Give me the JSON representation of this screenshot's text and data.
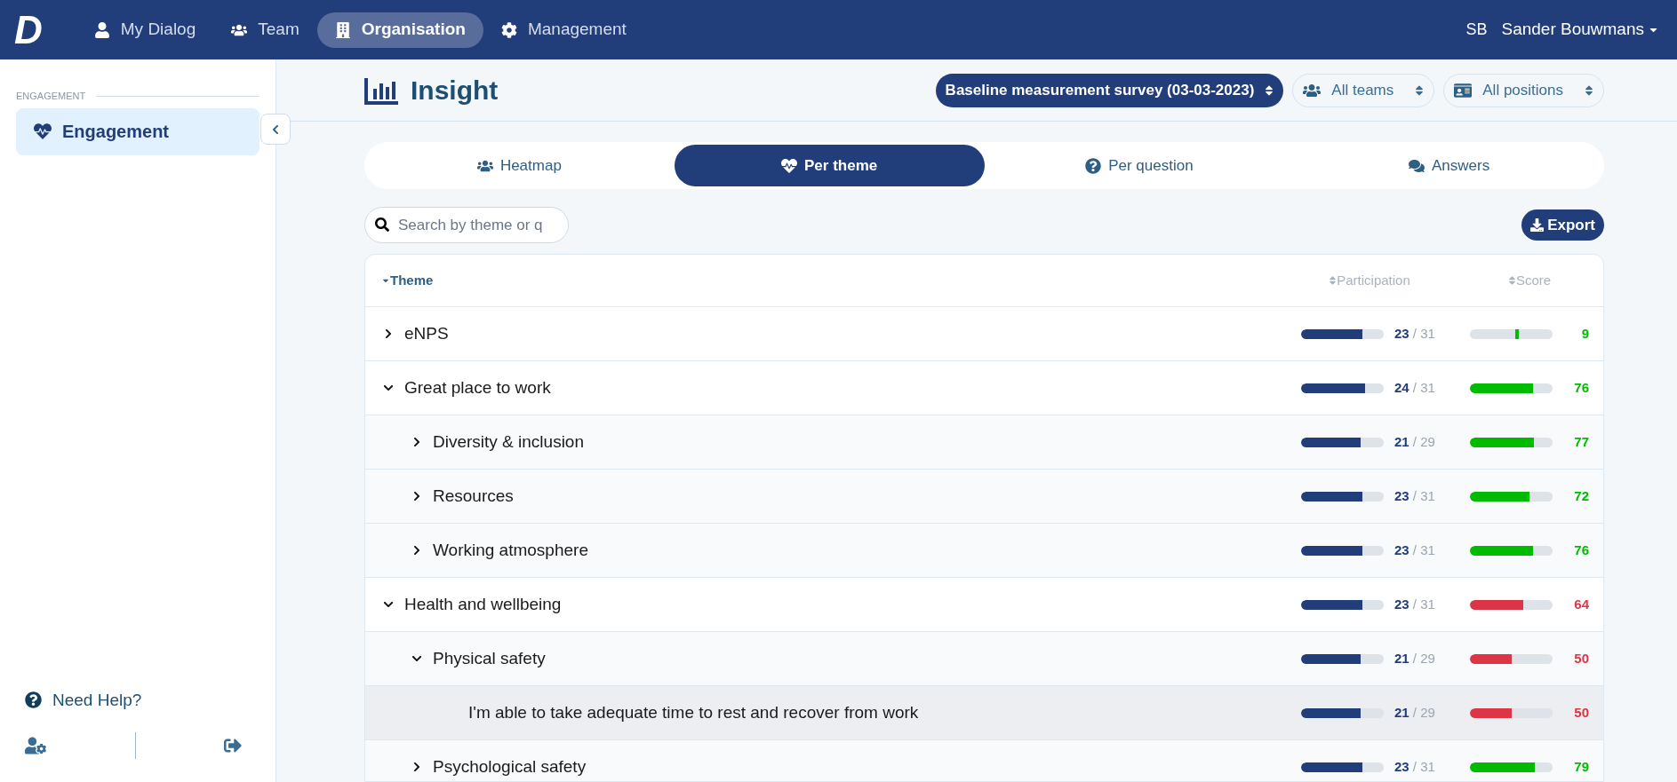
{
  "nav": {
    "logo": "D",
    "items": [
      {
        "label": "My Dialog",
        "selected": false
      },
      {
        "label": "Team",
        "selected": false
      },
      {
        "label": "Organisation",
        "selected": true
      },
      {
        "label": "Management",
        "selected": false
      }
    ],
    "user_initials": "SB",
    "user_name": "Sander Bouwmans"
  },
  "sidebar": {
    "section": "ENGAGEMENT",
    "items": [
      {
        "label": "Engagement",
        "selected": true
      }
    ],
    "help": "Need Help?"
  },
  "header": {
    "title": "Insight",
    "filters": [
      {
        "label": "Baseline measurement survey (03-03-2023)",
        "selected": true
      },
      {
        "label": "All teams",
        "selected": false
      },
      {
        "label": "All positions",
        "selected": false
      }
    ]
  },
  "tabs": [
    {
      "label": "Heatmap",
      "selected": false
    },
    {
      "label": "Per theme",
      "selected": true
    },
    {
      "label": "Per question",
      "selected": false
    },
    {
      "label": "Answers",
      "selected": false
    }
  ],
  "search": {
    "placeholder": "Search by theme or q"
  },
  "export_button": "Export",
  "table": {
    "columns": [
      "Theme",
      "Participation",
      "Score"
    ],
    "rows": [
      {
        "kind": "enps",
        "label": "eNPS",
        "expanded": false,
        "participation": {
          "answered": "23",
          "total": "/ 31",
          "level": 0.74
        },
        "score": {
          "value": "9",
          "level": 0.545,
          "color": "#00bb00"
        }
      },
      {
        "kind": "theme",
        "label": "Great place to work",
        "expanded": true,
        "participation": {
          "answered": "24",
          "total": "/ 31",
          "level": 0.77
        },
        "score": {
          "value": "76",
          "level": 0.76,
          "color": "#00bb00"
        },
        "children": [
          {
            "kind": "theme",
            "label": "Diversity & inclusion",
            "expanded": false,
            "participation": {
              "answered": "21",
              "total": "/ 29",
              "level": 0.72
            },
            "score": {
              "value": "77",
              "level": 0.77,
              "color": "#00bb00"
            }
          },
          {
            "kind": "theme",
            "label": "Resources",
            "expanded": false,
            "participation": {
              "answered": "23",
              "total": "/ 31",
              "level": 0.74
            },
            "score": {
              "value": "72",
              "level": 0.72,
              "color": "#00bb00"
            }
          },
          {
            "kind": "theme",
            "label": "Working atmosphere",
            "expanded": false,
            "participation": {
              "answered": "23",
              "total": "/ 31",
              "level": 0.74
            },
            "score": {
              "value": "76",
              "level": 0.76,
              "color": "#00bb00"
            }
          }
        ]
      },
      {
        "kind": "theme",
        "label": "Health and wellbeing",
        "expanded": true,
        "participation": {
          "answered": "23",
          "total": "/ 31",
          "level": 0.74
        },
        "score": {
          "value": "64",
          "level": 0.64,
          "color": "#dc3545"
        },
        "children": [
          {
            "kind": "theme",
            "label": "Physical safety",
            "expanded": true,
            "participation": {
              "answered": "21",
              "total": "/ 29",
              "level": 0.72
            },
            "score": {
              "value": "50",
              "level": 0.5,
              "color": "#dc3545"
            },
            "children": [
              {
                "kind": "question",
                "label": "I'm able to take adequate time to rest and recover from work",
                "highlighted": true,
                "participation": {
                  "answered": "21",
                  "total": "/ 29",
                  "level": 0.72
                },
                "score": {
                  "value": "50",
                  "level": 0.5,
                  "color": "#dc3545"
                }
              }
            ]
          },
          {
            "kind": "theme",
            "label": "Psychological safety",
            "expanded": false,
            "participation": {
              "answered": "23",
              "total": "/ 31",
              "level": 0.74
            },
            "score": {
              "value": "79",
              "level": 0.79,
              "color": "#00bb00"
            }
          }
        ]
      }
    ]
  }
}
